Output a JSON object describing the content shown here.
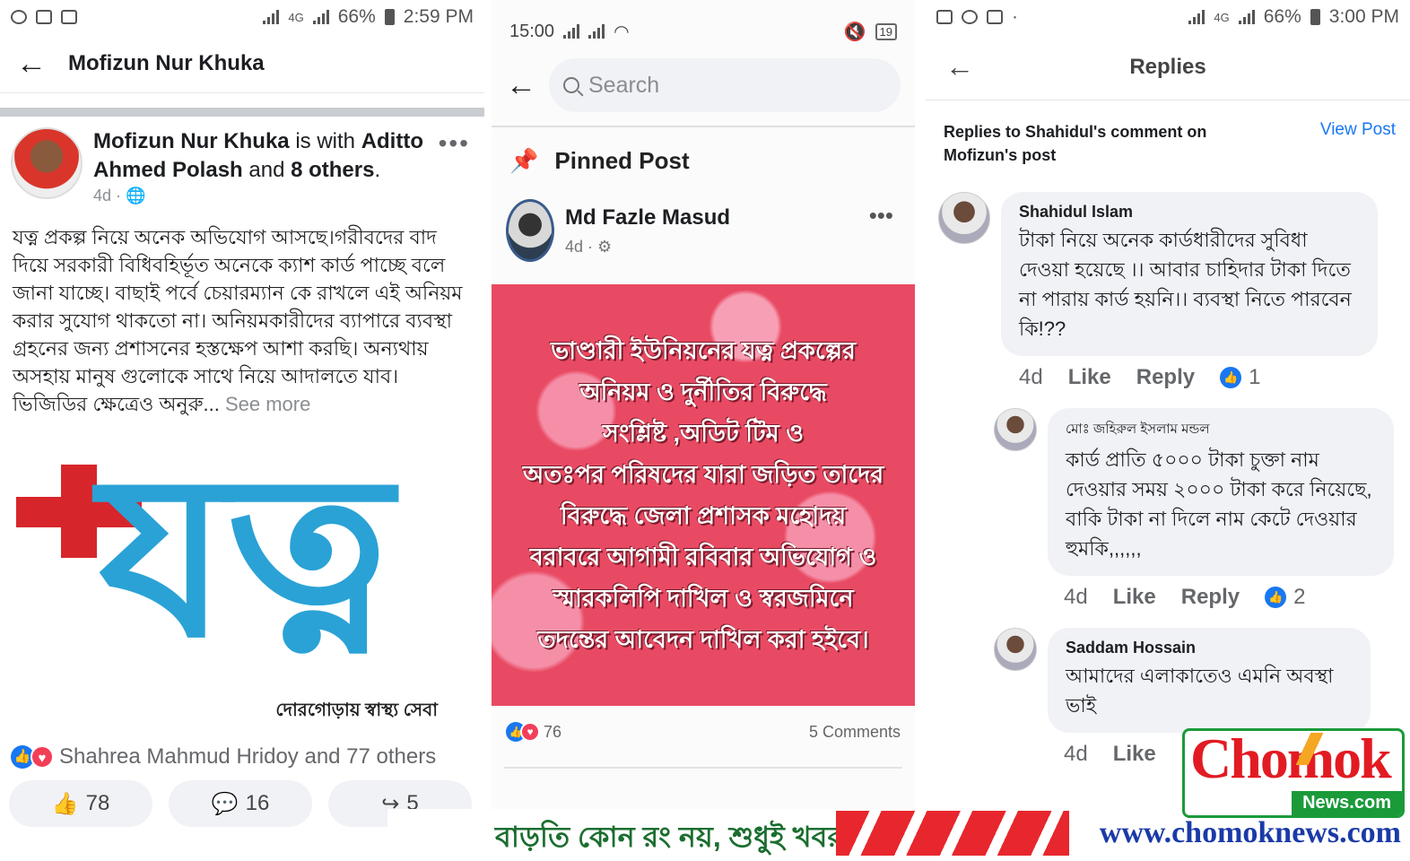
{
  "panel1": {
    "status": {
      "time": "2:59 PM",
      "battery": "66%",
      "network": "4G"
    },
    "header_title": "Mofizun Nur Khuka",
    "post": {
      "author": "Mofizun Nur Khuka",
      "with_text": "is with",
      "tagged": "Aditto Ahmed Polash",
      "and_text": "and",
      "others": "8 others",
      "time": "4d",
      "body": "যত্ন প্রকল্প নিয়ে অনেক অভিযোগ আসছে।গরীবদের বাদ দিয়ে সরকারী বিধিবহির্ভূত অনেকে ক্যাশ কার্ড পাচ্ছে বলে জানা যাচ্ছে। বাছাই পর্বে চেয়ারম্যান কে রাখলে এই অনিয়ম করার সুযোগ থাকতো না। অনিয়মকারীদের ব্যাপারে ব্যবস্থা গ্রহনের জন্য প্রশাসনের হস্তক্ষেপ আশা করছি। অন্যথায় অসহায় মানুষ গুলোকে সাথে নিয়ে আদালতে যাব।ভিজিডির ক্ষেত্রেও অনুরু...",
      "see_more": "See more",
      "logo_text": "যত্ন",
      "logo_tagline": "দোরগোড়ায় স্বাস্থ্য সেবা",
      "reactions_text": "Shahrea Mahmud Hridoy and 77 others",
      "likes": "78",
      "comments": "16",
      "shares": "5"
    }
  },
  "panel2": {
    "status": {
      "time": "15:00",
      "battery": "19"
    },
    "search_placeholder": "Search",
    "pinned_label": "Pinned Post",
    "post": {
      "author": "Md Fazle Masud",
      "time": "4d",
      "poster_lines": [
        "ভাণ্ডারী ইউনিয়নের যত্ন প্রকল্পের",
        "অনিয়ম ও দুর্নীতির বিরুদ্ধে",
        "সংশ্লিষ্ট ,অডিট টিম ও",
        "অতঃপর পরিষদের যারা জড়িত তাদের",
        "বিরুদ্ধে জেলা প্রশাসক মহোদয়",
        "বরাবরে আগামী রবিবার অভিযোগ ও",
        "স্মারকলিপি দাখিল ও স্বরজমিনে",
        "তদন্তের আবেদন দাখিল করা হইবে।"
      ],
      "reactions_count": "76",
      "comments_text": "5 Comments"
    }
  },
  "panel3": {
    "status": {
      "time": "3:00 PM",
      "battery": "66%",
      "network": "4G"
    },
    "header_title": "Replies",
    "replies_to": "Replies to Shahidul's comment on Mofizun's post",
    "view_post": "View Post",
    "comments": [
      {
        "name": "Shahidul Islam",
        "text": "টাকা নিয়ে অনেক কার্ডধারীদের সুবিধা দেওয়া হয়েছে ।। আবার চাহিদার টাকা দিতে না পারায় কার্ড হয়নি।। ব্যবস্থা নিতে পারবেন কি!??",
        "time": "4d",
        "like": "Like",
        "reply": "Reply",
        "reactions": "1"
      },
      {
        "name": "মোঃ জহিরুল ইসলাম মন্ডল",
        "text": "কার্ড প্রাতি ৫০০০ টাকা চুক্তা নাম দেওয়ার সময় ২০০০ টাকা করে নিয়েছে, বাকি টাকা না দিলে নাম কেটে দেওয়ার হুমকি,,,,,,",
        "time": "4d",
        "like": "Like",
        "reply": "Reply",
        "reactions": "2"
      },
      {
        "name": "Saddam Hossain",
        "text": "আমাদের এলাকাতেও এমনি অবস্থা ভাই",
        "time": "4d",
        "like": "Like"
      }
    ]
  },
  "watermark": {
    "tagline": "বাড়তি কোন রং নয়, শুধুই খবর",
    "url": "www.chomoknews.com",
    "logo_word": "Chomok",
    "logo_news": "News.com"
  },
  "colors": {
    "fb_blue": "#1877f2",
    "poster_red": "#e94a63",
    "logo_red": "#e21b23",
    "logo_green": "#1b9a3a",
    "yatna_blue": "#2aa2d6"
  }
}
